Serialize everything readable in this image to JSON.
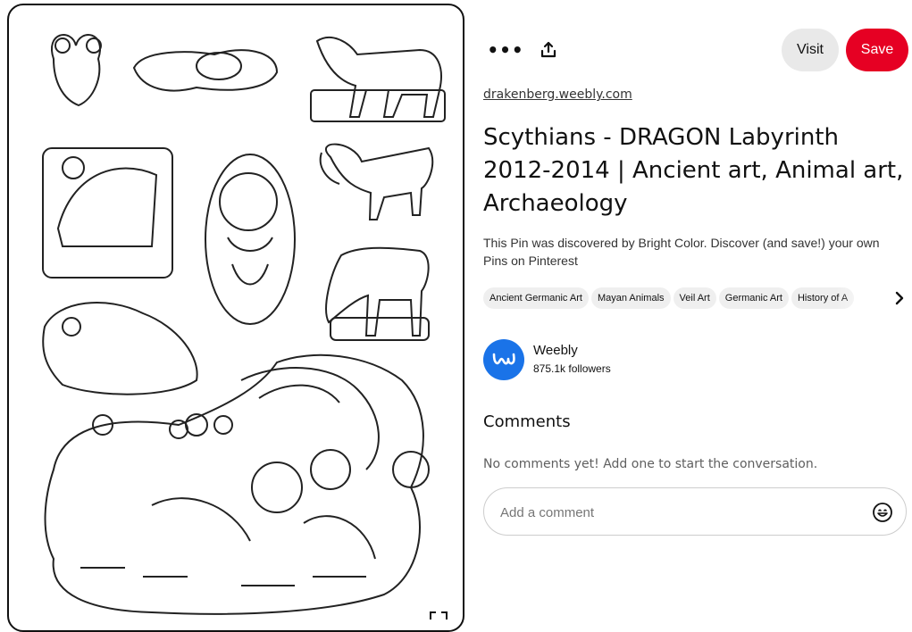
{
  "actions": {
    "more_label": "•••",
    "visit_label": "Visit",
    "save_label": "Save",
    "more_icon": "more-horizontal-icon",
    "share_icon": "share-upload-icon"
  },
  "pin": {
    "domain": "drakenberg.weebly.com",
    "title": "Scythians - DRAGON Labyrinth 2012-2014 | Ancient art, Animal art, Archaeology",
    "description": "This Pin was discovered by Bright Color. Discover (and save!) your own Pins on Pinterest",
    "tags": [
      "Ancient Germanic Art",
      "Mayan Animals",
      "Veil Art",
      "Germanic Art",
      "History of A"
    ]
  },
  "creator": {
    "name": "Weebly",
    "followers": "875.1k followers",
    "avatar_color": "#1a73e8"
  },
  "comments": {
    "heading": "Comments",
    "empty_text": "No comments yet! Add one to start the conversation.",
    "placeholder": "Add a comment"
  },
  "colors": {
    "save_button": "#e60023",
    "visit_button": "#e9e9e9"
  }
}
